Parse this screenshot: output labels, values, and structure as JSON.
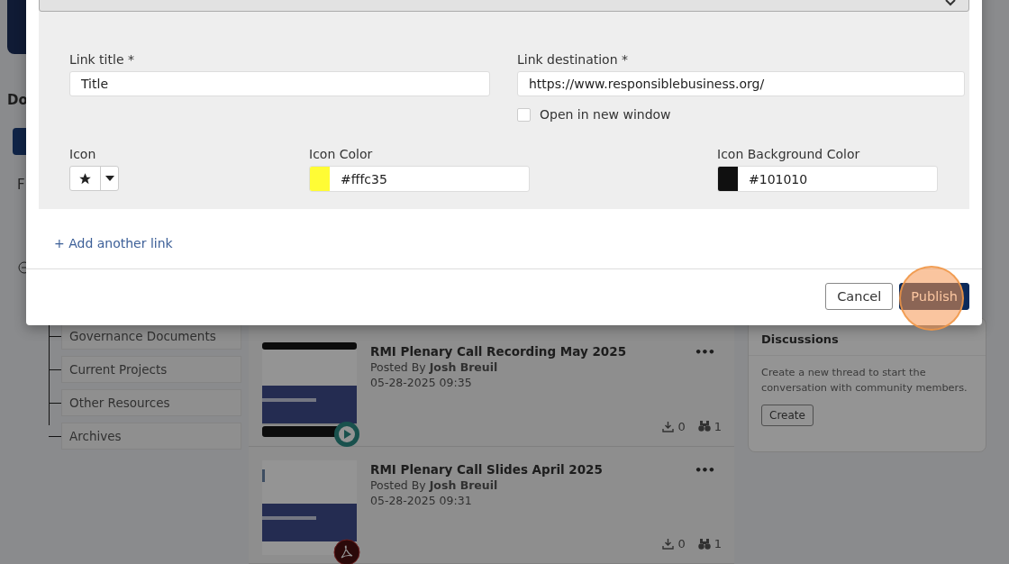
{
  "page": {
    "heading": "Do",
    "filter_label": "F"
  },
  "folders": [
    {
      "label": "Governance Documents"
    },
    {
      "label": "Current Projects"
    },
    {
      "label": "Other Resources"
    },
    {
      "label": "Archives"
    }
  ],
  "posts": [
    {
      "title": "RMI Plenary Call Recording May 2025",
      "posted_by": "Posted By",
      "author": "Josh Breuil",
      "date": "05-28-2025 09:35",
      "kind": "video",
      "downloads": "0",
      "views": "1",
      "more": "•••"
    },
    {
      "title": "RMI Plenary Call Slides April 2025",
      "posted_by": "Posted By",
      "author": "Josh Breuil",
      "date": "05-28-2025 09:31",
      "kind": "pdf",
      "downloads": "0",
      "views": "1",
      "more": "•••"
    }
  ],
  "discussions": {
    "title": "Discussions",
    "text": "Create a new thread to start the conversation with community members.",
    "button": "Create"
  },
  "dialog": {
    "link_title": {
      "label": "Link title *",
      "value": "Title"
    },
    "link_destination": {
      "label": "Link destination *",
      "value": "https://www.responsiblebusiness.org/"
    },
    "open_new_window": {
      "label": "Open in new window",
      "checked": false
    },
    "icon": {
      "label": "Icon"
    },
    "icon_color": {
      "label": "Icon Color",
      "value": "#fffc35",
      "color": "#fffc35"
    },
    "icon_background_color": {
      "label": "Icon Background Color",
      "value": "#101010",
      "color": "#101010"
    },
    "add_link": "+ Add another link",
    "buttons": [
      {
        "label": "Cancel",
        "kind": "secondary"
      },
      {
        "label": "Publish",
        "kind": "primary",
        "highlighted": true
      }
    ]
  }
}
